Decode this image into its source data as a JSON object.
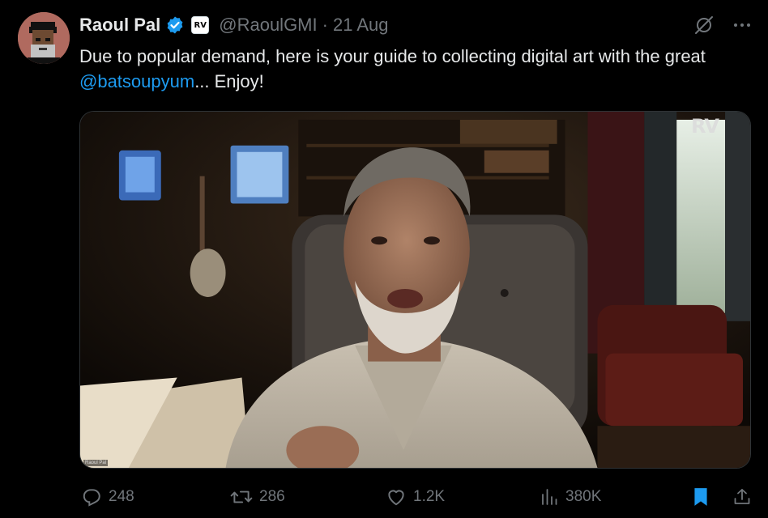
{
  "author": {
    "name": "Raoul Pal",
    "handle": "@RaoulGMI",
    "separator": "·",
    "date": "21 Aug",
    "affiliate_badge": "RV",
    "verified_color": "#1d9bf0"
  },
  "tweet": {
    "text_before": "Due to popular demand, here is your guide to collecting digital art with the great ",
    "mention": "@batsoupyum",
    "text_after": "... Enjoy!"
  },
  "media": {
    "watermark": "RV",
    "corner_label": "Raoul Pal"
  },
  "actions": {
    "replies": "248",
    "reposts": "286",
    "likes": "1.2K",
    "views": "380K",
    "bookmark_color": "#1d9bf0"
  },
  "icons": {
    "grok": "grok-icon",
    "more": "more-icon",
    "reply": "reply-icon",
    "repost": "repost-icon",
    "like": "heart-icon",
    "views": "views-icon",
    "bookmark": "bookmark-icon",
    "share": "share-icon"
  }
}
